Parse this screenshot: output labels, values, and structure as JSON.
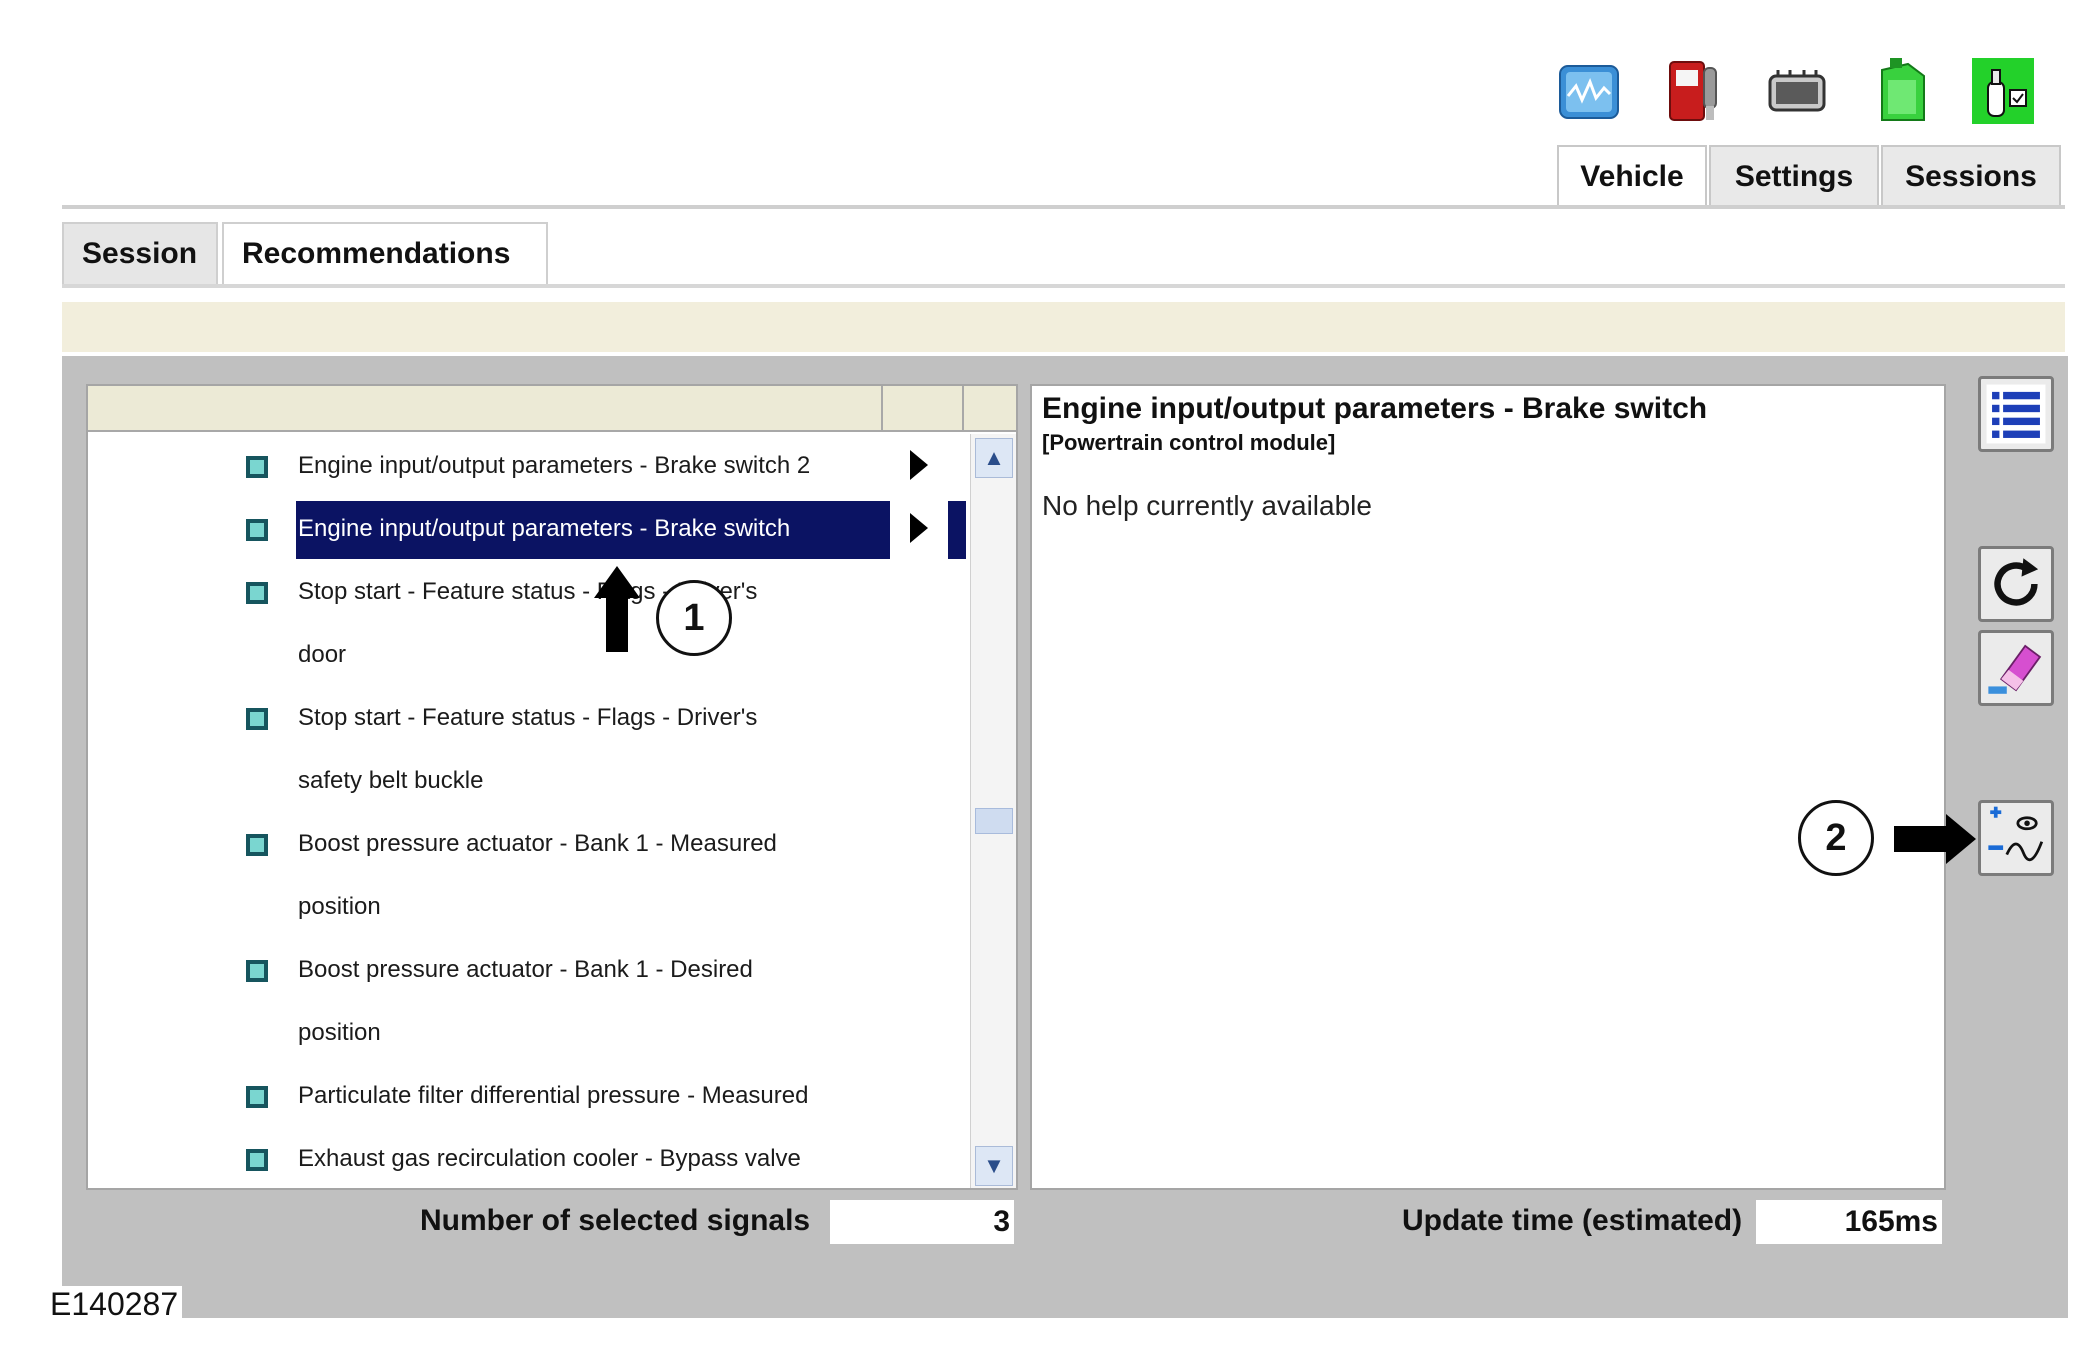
{
  "toolbar": {
    "icons": [
      "waveform-icon",
      "fuel-pump-icon",
      "module-icon",
      "fuel-can-icon",
      "checklist-icon"
    ]
  },
  "main_tabs": [
    "Vehicle",
    "Settings",
    "Sessions"
  ],
  "sub_tabs": [
    "Session",
    "Recommendations"
  ],
  "signals": [
    {
      "lines": [
        "Engine input/output parameters  -  Brake switch 2"
      ],
      "arrow": true,
      "selected": false
    },
    {
      "lines": [
        "Engine input/output parameters  -  Brake switch"
      ],
      "arrow": true,
      "selected": true
    },
    {
      "lines": [
        "Stop start  -  Feature status  -  Flags  -  Driver's",
        "door"
      ],
      "arrow": false,
      "selected": false
    },
    {
      "lines": [
        "Stop start  -  Feature status  -  Flags  -  Driver's",
        "safety belt buckle"
      ],
      "arrow": false,
      "selected": false
    },
    {
      "lines": [
        "Boost pressure actuator  -  Bank 1  -  Measured",
        "position"
      ],
      "arrow": false,
      "selected": false
    },
    {
      "lines": [
        "Boost pressure actuator  -  Bank 1  -  Desired",
        "position"
      ],
      "arrow": false,
      "selected": false
    },
    {
      "lines": [
        "Particulate filter differential pressure  -  Measured"
      ],
      "arrow": false,
      "selected": false
    },
    {
      "lines": [
        "Exhaust gas recirculation cooler  -  Bypass valve"
      ],
      "arrow": false,
      "selected": false
    }
  ],
  "help": {
    "title": "Engine input/output parameters  -  Brake switch",
    "subtitle": "[Powertrain control module]",
    "body": "No help currently available"
  },
  "footer": {
    "selected_label": "Number of selected signals",
    "selected_value": "3",
    "update_label": "Update time (estimated)",
    "update_value": "165ms"
  },
  "callouts": [
    "1",
    "2"
  ],
  "figure_label": "E140287"
}
